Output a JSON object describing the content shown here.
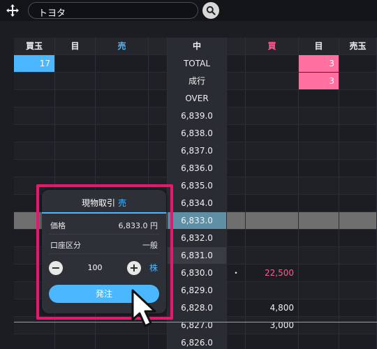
{
  "toolbar": {
    "search_value": "トヨタ"
  },
  "board": {
    "headers": [
      "買玉",
      "目",
      "売",
      "",
      "中",
      "",
      "買",
      "目",
      "売玉"
    ],
    "rows": [
      {
        "c0": "17",
        "c1": "",
        "c2": "",
        "c3": "",
        "c4": "TOTAL",
        "c5": "",
        "c6": "",
        "c7": "3",
        "c8": ""
      },
      {
        "c0": "",
        "c1": "",
        "c2": "",
        "c3": "",
        "c4": "成行",
        "c5": "",
        "c6": "",
        "c7": "3",
        "c8": ""
      },
      {
        "c0": "",
        "c1": "",
        "c2": "",
        "c3": "",
        "c4": "OVER",
        "c5": "",
        "c6": "",
        "c7": "",
        "c8": ""
      },
      {
        "c0": "",
        "c1": "",
        "c2": "",
        "c3": "",
        "c4": "6,839.0",
        "c5": "",
        "c6": "",
        "c7": "",
        "c8": ""
      },
      {
        "c0": "",
        "c1": "",
        "c2": "",
        "c3": "",
        "c4": "6,838.0",
        "c5": "",
        "c6": "",
        "c7": "",
        "c8": ""
      },
      {
        "c0": "",
        "c1": "",
        "c2": "",
        "c3": "",
        "c4": "6,837.0",
        "c5": "",
        "c6": "",
        "c7": "",
        "c8": ""
      },
      {
        "c0": "",
        "c1": "",
        "c2": "",
        "c3": "",
        "c4": "6,836.0",
        "c5": "",
        "c6": "",
        "c7": "",
        "c8": ""
      },
      {
        "c0": "",
        "c1": "",
        "c2": "",
        "c3": "",
        "c4": "6,835.0",
        "c5": "",
        "c6": "",
        "c7": "",
        "c8": ""
      },
      {
        "c0": "",
        "c1": "",
        "c2": "",
        "c3": "",
        "c4": "6,834.0",
        "c5": "",
        "c6": "",
        "c7": "",
        "c8": ""
      },
      {
        "c0": "",
        "c1": "",
        "c2": "",
        "c3": "",
        "c4": "6,833.0",
        "c5": "",
        "c6": "",
        "c7": "",
        "c8": ""
      },
      {
        "c0": "",
        "c1": "",
        "c2": "",
        "c3": "",
        "c4": "6,832.0",
        "c5": "",
        "c6": "",
        "c7": "",
        "c8": ""
      },
      {
        "c0": "",
        "c1": "",
        "c2": "",
        "c3": "",
        "c4": "6,831.0",
        "c5": "",
        "c6": "",
        "c7": "",
        "c8": ""
      },
      {
        "c0": "",
        "c1": "",
        "c2": "",
        "c3": "",
        "c4": "6,830.0",
        "c5": "・",
        "c6": "22,500",
        "c7": "",
        "c8": ""
      },
      {
        "c0": "",
        "c1": "",
        "c2": "",
        "c3": "",
        "c4": "6,829.0",
        "c5": "",
        "c6": "",
        "c7": "",
        "c8": ""
      },
      {
        "c0": "",
        "c1": "",
        "c2": "",
        "c3": "",
        "c4": "6,828.0",
        "c5": "",
        "c6": "4,800",
        "c7": "",
        "c8": ""
      },
      {
        "c0": "",
        "c1": "",
        "c2": "",
        "c3": "",
        "c4": "6,827.0",
        "c5": "",
        "c6": "3,000",
        "c7": "",
        "c8": ""
      },
      {
        "c0": "",
        "c1": "",
        "c2": "",
        "c3": "",
        "c4": "6,826.0",
        "c5": "",
        "c6": "",
        "c7": "",
        "c8": ""
      }
    ]
  },
  "order_panel": {
    "kind": "現物取引",
    "side": "売",
    "price_label": "価格",
    "price_value": "6,833.0 円",
    "account_label": "口座区分",
    "account_value": "一般",
    "quantity": "100",
    "unit": "株",
    "submit_label": "発注"
  },
  "colors": {
    "accent_blue": "#4ab7ff",
    "accent_pink": "#ff6fa0",
    "highlight_frame": "#e8186f"
  },
  "icons": {
    "move": "move-arrows-icon",
    "search": "search-icon",
    "cursor": "mouse-pointer-icon"
  }
}
